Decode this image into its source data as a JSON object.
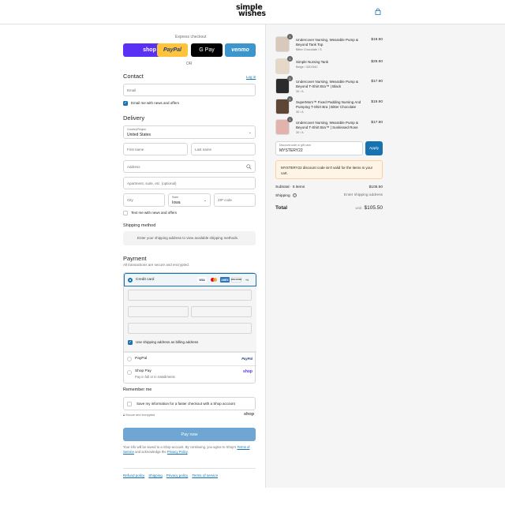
{
  "header": {
    "logo_line1": "simple",
    "logo_line2": "wishes"
  },
  "express": {
    "title": "Express checkout",
    "buttons": [
      "shop",
      "PayPal",
      "G Pay",
      "venmo"
    ],
    "or": "OR"
  },
  "contact": {
    "title": "Contact",
    "login_link": "Log in",
    "email_placeholder": "Email",
    "newsletter_label": "Email me with news and offers"
  },
  "delivery": {
    "title": "Delivery",
    "country_label": "Country/Region",
    "country_value": "United States",
    "first_name": "First name",
    "last_name": "Last name",
    "address": "Address",
    "apartment": "Apartment, suite, etc. (optional)",
    "city": "City",
    "state_label": "State",
    "state_value": "Iowa",
    "zip": "ZIP code",
    "text_label": "Text me with news and offers"
  },
  "shipping_method": {
    "title": "Shipping method",
    "message": "Enter your shipping address to view available shipping methods."
  },
  "payment": {
    "title": "Payment",
    "subtitle": "All transactions are secure and encrypted.",
    "credit_card": "Credit card",
    "brands": [
      "VISA",
      "MC",
      "AMEX",
      "DISCOVER",
      "+4"
    ],
    "billing_label": "Use shipping address as billing address",
    "paypal": "PayPal",
    "paypal_logo": "PayPal",
    "shop_pay": "Shop Pay",
    "shop_pay_sub": "Pay in full or in installments",
    "shop_logo": "shop"
  },
  "remember": {
    "title": "Remember me",
    "save_label": "Save my information for a faster checkout with a Shop account",
    "secure": "Secure and encrypted",
    "shop_logo": "shop"
  },
  "paynow": "Pay now",
  "legal": {
    "before": "Your info will be saved to a Shop account. By continuing, you agree to Shop's ",
    "tos": "Terms of Service",
    "middle": " and acknowledge the ",
    "privacy": "Privacy Policy",
    "after": "."
  },
  "footer": [
    "Refund policy",
    "Shipping",
    "Privacy policy",
    "Terms of service"
  ],
  "cart": {
    "items": [
      {
        "qty": "1",
        "name": "Undercover Nursing, Wearable Pump & Beyond Tank Top",
        "variant": "Bitter Chocolate / S",
        "price": "$19.90"
      },
      {
        "qty": "1",
        "name": "Simple Nursing Tank",
        "variant": "Beige / 32D/34C",
        "price": "$29.90"
      },
      {
        "qty": "1",
        "name": "Undercover Nursing, Wearable Pump & Beyond T-Shirt Bra™ | Black",
        "variant": "30 / A",
        "price": "$17.90"
      },
      {
        "qty": "1",
        "name": "SuperMom™ Fixed Padding Nursing And Pumping T-Shirt Bra | Bitter Chocolate",
        "variant": "30 / A",
        "price": "$19.90"
      },
      {
        "qty": "1",
        "name": "Undercover Nursing, Wearable Pump & Beyond T-Shirt Bra™ | Sunkissed Rose",
        "variant": "30 / A",
        "price": "$17.90"
      }
    ],
    "discount_label": "Discount code or gift card",
    "discount_value": "MYSTERY22",
    "apply": "Apply",
    "warning": "MYSTERY22 discount code isn't valid for the items in your cart.",
    "subtotal_label": "Subtotal · 5 items",
    "subtotal": "$105.50",
    "shipping_label": "Shipping",
    "shipping_value": "Enter shipping address",
    "total_label": "Total",
    "currency": "USD",
    "total": "$105.50"
  }
}
